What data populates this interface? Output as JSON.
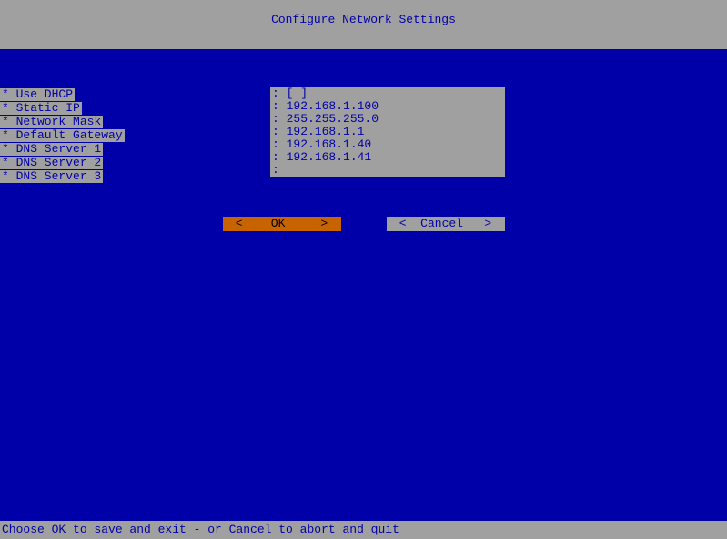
{
  "title": "Configure Network Settings",
  "fields": [
    {
      "label": "* Use DHCP",
      "value": "[ ]"
    },
    {
      "label": "* Static IP",
      "value": "192.168.1.100"
    },
    {
      "label": "* Network Mask",
      "value": "255.255.255.0"
    },
    {
      "label": "* Default Gateway",
      "value": "192.168.1.1"
    },
    {
      "label": "* DNS Server 1",
      "value": "192.168.1.40"
    },
    {
      "label": "* DNS Server 2",
      "value": "192.168.1.41"
    },
    {
      "label": "* DNS Server 3",
      "value": ""
    }
  ],
  "buttons": {
    "ok": "<    OK     >",
    "cancel": "<  Cancel   >"
  },
  "status": "Choose OK to save and exit - or Cancel to abort and quit"
}
